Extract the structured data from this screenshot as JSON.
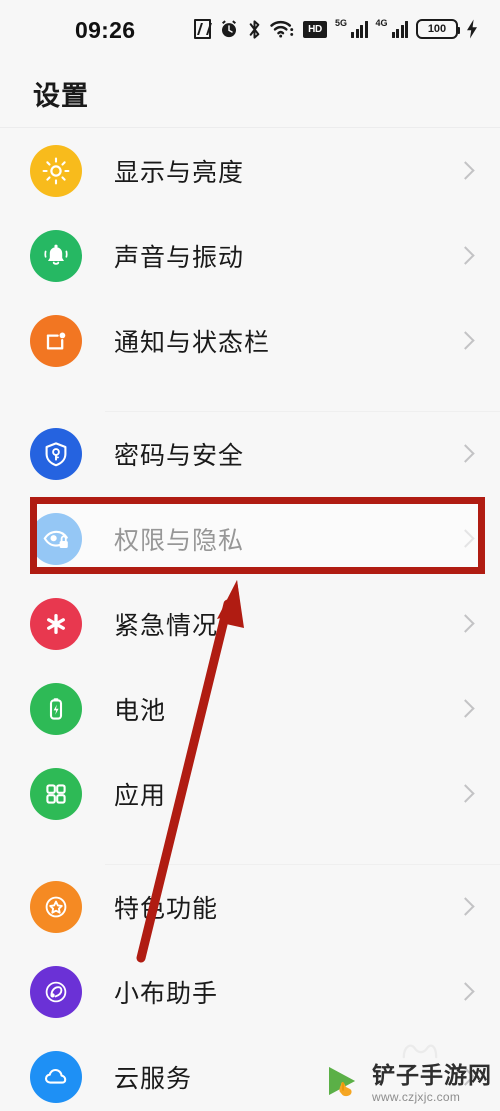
{
  "status_bar": {
    "time": "09:26",
    "battery_level": "100",
    "icons": [
      {
        "name": "nfc-icon",
        "label": "N"
      },
      {
        "name": "alarm-icon",
        "label": "alarm"
      },
      {
        "name": "bluetooth-icon",
        "label": "bluetooth"
      },
      {
        "name": "wifi-icon",
        "label": "wifi"
      },
      {
        "name": "hd-voice-icon",
        "label": "HD"
      },
      {
        "name": "signal-5g-icon",
        "label": "5G"
      },
      {
        "name": "signal-4g-icon",
        "label": "4G"
      },
      {
        "name": "battery-icon",
        "label": "100"
      },
      {
        "name": "charging-icon",
        "label": "charging"
      }
    ],
    "network_5g_label": "5G",
    "network_4g_label": "4G",
    "hd_label": "HD"
  },
  "header": {
    "title": "设置"
  },
  "groups": [
    {
      "items": [
        {
          "label": "显示与亮度",
          "icon": "brightness-icon",
          "color": "#f8bb1c"
        },
        {
          "label": "声音与振动",
          "icon": "bell-icon",
          "color": "#26b863"
        },
        {
          "label": "通知与状态栏",
          "icon": "notification-icon",
          "color": "#f27622"
        }
      ]
    },
    {
      "items": [
        {
          "label": "密码与安全",
          "icon": "shield-key-icon",
          "color": "#2563e0"
        },
        {
          "label": "权限与隐私",
          "icon": "eye-lock-icon",
          "color": "#1583e8",
          "highlighted": true
        },
        {
          "label": "紧急情况",
          "icon": "emergency-icon",
          "color": "#e8384f"
        },
        {
          "label": "电池",
          "icon": "battery-icon",
          "color": "#2eba56"
        },
        {
          "label": "应用",
          "icon": "apps-grid-icon",
          "color": "#2eba56"
        }
      ]
    },
    {
      "items": [
        {
          "label": "特色功能",
          "icon": "star-circle-icon",
          "color": "#f58a23"
        },
        {
          "label": "小布助手",
          "icon": "assistant-icon",
          "color": "#6b31d6"
        },
        {
          "label": "云服务",
          "icon": "cloud-icon",
          "color": "#1e90f5"
        }
      ]
    }
  ],
  "annotations": {
    "highlight_color": "#b01c12",
    "arrow_color": "#b01c12",
    "highlight_target": "权限与隐私"
  },
  "watermark": {
    "title": "铲子手游网",
    "url": "www.czjxjc.com"
  }
}
